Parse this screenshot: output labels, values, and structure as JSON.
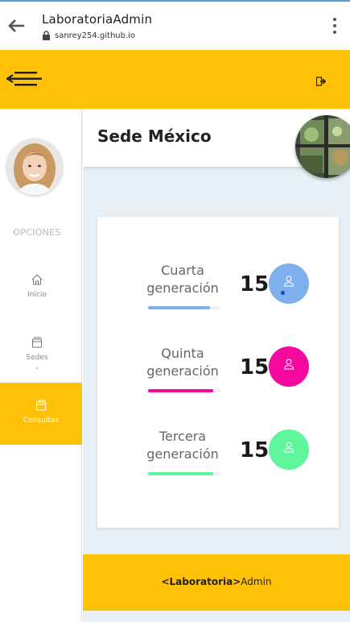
{
  "browser": {
    "title": "LaboratoriaAdmin",
    "url": "sanrey254.github.io"
  },
  "sidebar": {
    "section_label": "OPCIONES",
    "items": [
      {
        "label": "Inicio",
        "icon": "home-icon"
      },
      {
        "label": "Sedes",
        "icon": "window-icon"
      },
      {
        "label": "Consultas",
        "icon": "window-icon"
      }
    ]
  },
  "main": {
    "sede_title": "Sede México"
  },
  "stats": [
    {
      "line1": "Cuarta",
      "line2": "generación",
      "count": "15",
      "color": "#7eb0ee",
      "progress": 0.85
    },
    {
      "line1": "Quinta",
      "line2": "generación",
      "count": "15",
      "color": "#f4089e",
      "progress": 0.9
    },
    {
      "line1": "Tercera",
      "line2": "generación",
      "count": "15",
      "color": "#5ff59a",
      "progress": 0.9
    }
  ],
  "footer": {
    "bold": "<Laboratoria>",
    "rest": "Admin"
  },
  "colors": {
    "accent": "#ffc107",
    "background": "#eaf1f6"
  }
}
